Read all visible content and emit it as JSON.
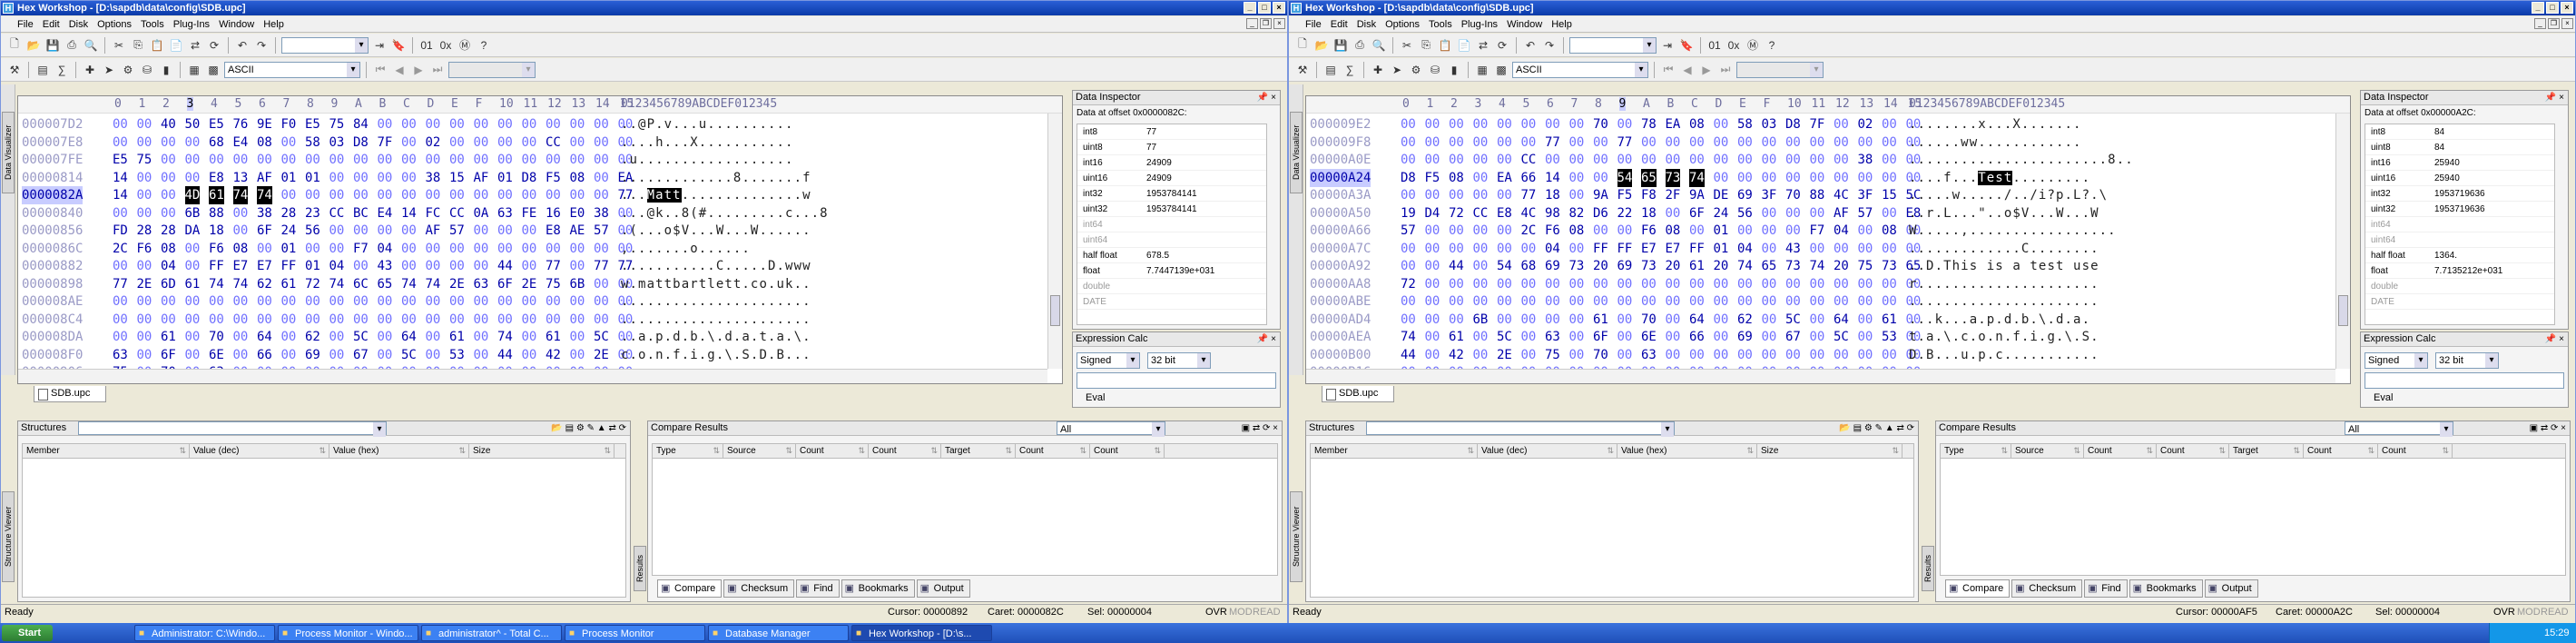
{
  "left": {
    "title": "Hex Workshop - [D:\\sapdb\\data\\config\\SDB.upc]",
    "menu": [
      "File",
      "Edit",
      "Disk",
      "Options",
      "Tools",
      "Plug-Ins",
      "Window",
      "Help"
    ],
    "encoding": "ASCII",
    "vtab_label": "Data Visualizer",
    "col_headers": [
      "0",
      "1",
      "2",
      "3",
      "4",
      "5",
      "6",
      "7",
      "8",
      "9",
      "A",
      "B",
      "C",
      "D",
      "E",
      "F",
      "10",
      "11",
      "12",
      "13",
      "14",
      "15"
    ],
    "ascii_header": "0123456789ABCDEF012345",
    "rows": [
      {
        "off": "000007D2",
        "bytes": [
          "00",
          "00",
          "40",
          "50",
          "E5",
          "76",
          "9E",
          "F0",
          "E5",
          "75",
          "84",
          "00",
          "00",
          "00",
          "00",
          "00",
          "00",
          "00",
          "00",
          "00",
          "00",
          "00"
        ],
        "ascii": "..@P.v...u.........."
      },
      {
        "off": "000007E8",
        "bytes": [
          "00",
          "00",
          "00",
          "00",
          "68",
          "E4",
          "08",
          "00",
          "58",
          "03",
          "D8",
          "7F",
          "00",
          "02",
          "00",
          "00",
          "00",
          "00",
          "CC",
          "00",
          "00",
          "00"
        ],
        "ascii": "....h...X..........."
      },
      {
        "off": "000007FE",
        "bytes": [
          "E5",
          "75",
          "00",
          "00",
          "00",
          "00",
          "00",
          "00",
          "00",
          "00",
          "00",
          "00",
          "00",
          "00",
          "00",
          "00",
          "00",
          "00",
          "00",
          "00",
          "00",
          "00"
        ],
        "ascii": ".u.................."
      },
      {
        "off": "00000814",
        "bytes": [
          "14",
          "00",
          "00",
          "00",
          "E8",
          "13",
          "AF",
          "01",
          "01",
          "00",
          "00",
          "00",
          "00",
          "38",
          "15",
          "AF",
          "01",
          "D8",
          "F5",
          "08",
          "00",
          "EA"
        ],
        "ascii": ".............8.......f"
      },
      {
        "off": "0000082A",
        "bytes": [
          "14",
          "00",
          "00",
          "4D",
          "61",
          "74",
          "74",
          "00",
          "00",
          "00",
          "00",
          "00",
          "00",
          "00",
          "00",
          "00",
          "00",
          "00",
          "00",
          "00",
          "00",
          "77"
        ],
        "ascii": "...Matt..............w",
        "cur": true,
        "sel": [
          3,
          4,
          5,
          6
        ],
        "hl": [
          "...",
          "Matt",
          "..............w"
        ]
      },
      {
        "off": "00000840",
        "bytes": [
          "00",
          "00",
          "00",
          "6B",
          "88",
          "00",
          "38",
          "28",
          "23",
          "CC",
          "BC",
          "E4",
          "14",
          "FC",
          "CC",
          "0A",
          "63",
          "FE",
          "16",
          "E0",
          "38",
          "00"
        ],
        "ascii": "...@k..8(#.........c...8"
      },
      {
        "off": "00000856",
        "bytes": [
          "FD",
          "28",
          "28",
          "DA",
          "18",
          "00",
          "6F",
          "24",
          "56",
          "00",
          "00",
          "00",
          "00",
          "AF",
          "57",
          "00",
          "00",
          "00",
          "E8",
          "AE",
          "57",
          "00"
        ],
        "ascii": ".(...o$V...W...W......"
      },
      {
        "off": "0000086C",
        "bytes": [
          "2C",
          "F6",
          "08",
          "00",
          "F6",
          "08",
          "00",
          "01",
          "00",
          "00",
          "F7",
          "04",
          "00",
          "00",
          "00",
          "00",
          "00",
          "00",
          "00",
          "00",
          "00",
          "00"
        ],
        "ascii": ",.......o......"
      },
      {
        "off": "00000882",
        "bytes": [
          "00",
          "00",
          "04",
          "00",
          "FF",
          "E7",
          "E7",
          "FF",
          "01",
          "04",
          "00",
          "43",
          "00",
          "00",
          "00",
          "00",
          "44",
          "00",
          "77",
          "00",
          "77",
          "77"
        ],
        "ascii": "...........C.....D.www"
      },
      {
        "off": "00000898",
        "bytes": [
          "77",
          "2E",
          "6D",
          "61",
          "74",
          "74",
          "62",
          "61",
          "72",
          "74",
          "6C",
          "65",
          "74",
          "74",
          "2E",
          "63",
          "6F",
          "2E",
          "75",
          "6B",
          "00",
          "00"
        ],
        "ascii": "w.mattbartlett.co.uk.."
      },
      {
        "off": "000008AE",
        "bytes": [
          "00",
          "00",
          "00",
          "00",
          "00",
          "00",
          "00",
          "00",
          "00",
          "00",
          "00",
          "00",
          "00",
          "00",
          "00",
          "00",
          "00",
          "00",
          "00",
          "00",
          "00",
          "00"
        ],
        "ascii": "......................"
      },
      {
        "off": "000008C4",
        "bytes": [
          "00",
          "00",
          "00",
          "00",
          "00",
          "00",
          "00",
          "00",
          "00",
          "00",
          "00",
          "00",
          "00",
          "00",
          "00",
          "00",
          "00",
          "00",
          "00",
          "00",
          "00",
          "00"
        ],
        "ascii": "......................"
      },
      {
        "off": "000008DA",
        "bytes": [
          "00",
          "00",
          "61",
          "00",
          "70",
          "00",
          "64",
          "00",
          "62",
          "00",
          "5C",
          "00",
          "64",
          "00",
          "61",
          "00",
          "74",
          "00",
          "61",
          "00",
          "5C",
          "00"
        ],
        "ascii": "..a.p.d.b.\\.d.a.t.a.\\."
      },
      {
        "off": "000008F0",
        "bytes": [
          "63",
          "00",
          "6F",
          "00",
          "6E",
          "00",
          "66",
          "00",
          "69",
          "00",
          "67",
          "00",
          "5C",
          "00",
          "53",
          "00",
          "44",
          "00",
          "42",
          "00",
          "2E",
          "00"
        ],
        "ascii": "c.o.n.f.i.g.\\.S.D.B..."
      },
      {
        "off": "00000906",
        "bytes": [
          "75",
          "00",
          "70",
          "00",
          "63",
          "00",
          "00",
          "00",
          "00",
          "00",
          "00",
          "00",
          "00",
          "00",
          "00",
          "00",
          "00",
          "00",
          "00",
          "00",
          "00",
          "00"
        ],
        "ascii": "u.p.c................."
      }
    ],
    "doc_tab": "SDB.upc",
    "inspector": {
      "title": "Data Inspector",
      "offset": "Data at offset 0x0000082C:",
      "rows": [
        {
          "k": "int8",
          "v": "77"
        },
        {
          "k": "uint8",
          "v": "77"
        },
        {
          "k": "int16",
          "v": "24909"
        },
        {
          "k": "uint16",
          "v": "24909"
        },
        {
          "k": "int32",
          "v": "1953784141"
        },
        {
          "k": "uint32",
          "v": "1953784141"
        },
        {
          "k": "int64",
          "v": "",
          "grey": true
        },
        {
          "k": "uint64",
          "v": "",
          "grey": true
        },
        {
          "k": "half float",
          "v": "678.5"
        },
        {
          "k": "float",
          "v": "7.7447139e+031"
        },
        {
          "k": "double",
          "v": "",
          "grey": true
        },
        {
          "k": "DATE",
          "v": "",
          "grey": true
        }
      ]
    },
    "expr": {
      "title": "Expression Calc",
      "mode": "Signed",
      "bits": "32 bit",
      "eval": "Eval"
    },
    "structures": {
      "title": "Structures",
      "cols": [
        "Member",
        "Value (dec)",
        "Value (hex)",
        "Size"
      ],
      "vlabel": "Structure Viewer"
    },
    "compare": {
      "title": "Compare Results",
      "filter": "All",
      "cols": [
        "Type",
        "Source",
        "Count",
        "Count",
        "Target",
        "Count",
        "Count"
      ],
      "vlabel": "Results"
    },
    "bottom_tabs": [
      "Compare",
      "Checksum",
      "Find",
      "Bookmarks",
      "Output"
    ],
    "status": {
      "ready": "Ready",
      "cursor": "Cursor: 00000892",
      "caret": "Caret: 0000082C",
      "sel": "Sel: 00000004",
      "ovr": "OVR",
      "mod": "MOD",
      "read": "READ"
    }
  },
  "right": {
    "title": "Hex Workshop - [D:\\sapdb\\data\\config\\SDB.upc]",
    "menu": [
      "File",
      "Edit",
      "Disk",
      "Options",
      "Tools",
      "Plug-Ins",
      "Window",
      "Help"
    ],
    "encoding": "ASCII",
    "vtab_label": "Data Visualizer",
    "col_headers": [
      "0",
      "1",
      "2",
      "3",
      "4",
      "5",
      "6",
      "7",
      "8",
      "9",
      "A",
      "B",
      "C",
      "D",
      "E",
      "F",
      "10",
      "11",
      "12",
      "13",
      "14",
      "15"
    ],
    "ascii_header": "0123456789ABCDEF012345",
    "rows": [
      {
        "off": "000009E2",
        "bytes": [
          "00",
          "00",
          "00",
          "00",
          "00",
          "00",
          "00",
          "00",
          "70",
          "00",
          "78",
          "EA",
          "08",
          "00",
          "58",
          "03",
          "D8",
          "7F",
          "00",
          "02",
          "00",
          "00"
        ],
        "ascii": "........x...X......."
      },
      {
        "off": "000009F8",
        "bytes": [
          "00",
          "00",
          "00",
          "00",
          "00",
          "00",
          "77",
          "00",
          "00",
          "77",
          "00",
          "00",
          "00",
          "00",
          "00",
          "00",
          "00",
          "00",
          "00",
          "00",
          "00",
          "00"
        ],
        "ascii": "......ww............"
      },
      {
        "off": "00000A0E",
        "bytes": [
          "00",
          "00",
          "00",
          "00",
          "00",
          "CC",
          "00",
          "00",
          "00",
          "00",
          "00",
          "00",
          "00",
          "00",
          "00",
          "00",
          "00",
          "00",
          "00",
          "38",
          "00",
          "00"
        ],
        "ascii": ".......................8.."
      },
      {
        "off": "00000A24",
        "bytes": [
          "D8",
          "F5",
          "08",
          "00",
          "EA",
          "66",
          "14",
          "00",
          "00",
          "54",
          "65",
          "73",
          "74",
          "00",
          "00",
          "00",
          "00",
          "00",
          "00",
          "00",
          "00",
          "00"
        ],
        "ascii": "....f...Test.........",
        "cur": true,
        "sel": [
          9,
          10,
          11,
          12
        ],
        "hl": [
          "....f...",
          "Test",
          "........."
        ]
      },
      {
        "off": "00000A3A",
        "bytes": [
          "00",
          "00",
          "00",
          "00",
          "00",
          "77",
          "18",
          "00",
          "9A",
          "F5",
          "F8",
          "2F",
          "9A",
          "DE",
          "69",
          "3F",
          "70",
          "88",
          "4C",
          "3F",
          "15",
          "5C"
        ],
        "ascii": ".....w...../../i?p.L?.\\"
      },
      {
        "off": "00000A50",
        "bytes": [
          "19",
          "D4",
          "72",
          "CC",
          "E8",
          "4C",
          "98",
          "82",
          "D6",
          "22",
          "18",
          "00",
          "6F",
          "24",
          "56",
          "00",
          "00",
          "00",
          "AF",
          "57",
          "00",
          "E8"
        ],
        "ascii": "..r.L...\"..o$V...W...W"
      },
      {
        "off": "00000A66",
        "bytes": [
          "57",
          "00",
          "00",
          "00",
          "00",
          "2C",
          "F6",
          "08",
          "00",
          "00",
          "F6",
          "08",
          "00",
          "01",
          "00",
          "00",
          "00",
          "F7",
          "04",
          "00",
          "08",
          "00"
        ],
        "ascii": "W.....,................."
      },
      {
        "off": "00000A7C",
        "bytes": [
          "00",
          "00",
          "00",
          "00",
          "00",
          "00",
          "04",
          "00",
          "FF",
          "FF",
          "E7",
          "E7",
          "FF",
          "01",
          "04",
          "00",
          "43",
          "00",
          "00",
          "00",
          "00",
          "00"
        ],
        "ascii": ".............C........"
      },
      {
        "off": "00000A92",
        "bytes": [
          "00",
          "00",
          "44",
          "00",
          "54",
          "68",
          "69",
          "73",
          "20",
          "69",
          "73",
          "20",
          "61",
          "20",
          "74",
          "65",
          "73",
          "74",
          "20",
          "75",
          "73",
          "65"
        ],
        "ascii": "..D.This is a test use"
      },
      {
        "off": "00000AA8",
        "bytes": [
          "72",
          "00",
          "00",
          "00",
          "00",
          "00",
          "00",
          "00",
          "00",
          "00",
          "00",
          "00",
          "00",
          "00",
          "00",
          "00",
          "00",
          "00",
          "00",
          "00",
          "00",
          "00"
        ],
        "ascii": "r....................."
      },
      {
        "off": "00000ABE",
        "bytes": [
          "00",
          "00",
          "00",
          "00",
          "00",
          "00",
          "00",
          "00",
          "00",
          "00",
          "00",
          "00",
          "00",
          "00",
          "00",
          "00",
          "00",
          "00",
          "00",
          "00",
          "00",
          "00"
        ],
        "ascii": "......................"
      },
      {
        "off": "00000AD4",
        "bytes": [
          "00",
          "00",
          "00",
          "6B",
          "00",
          "00",
          "00",
          "00",
          "61",
          "00",
          "70",
          "00",
          "64",
          "00",
          "62",
          "00",
          "5C",
          "00",
          "64",
          "00",
          "61",
          "00"
        ],
        "ascii": "...k...a.p.d.b.\\.d.a."
      },
      {
        "off": "00000AEA",
        "bytes": [
          "74",
          "00",
          "61",
          "00",
          "5C",
          "00",
          "63",
          "00",
          "6F",
          "00",
          "6E",
          "00",
          "66",
          "00",
          "69",
          "00",
          "67",
          "00",
          "5C",
          "00",
          "53",
          "00"
        ],
        "ascii": "t.a.\\.c.o.n.f.i.g.\\.S."
      },
      {
        "off": "00000B00",
        "bytes": [
          "44",
          "00",
          "42",
          "00",
          "2E",
          "00",
          "75",
          "00",
          "70",
          "00",
          "63",
          "00",
          "00",
          "00",
          "00",
          "00",
          "00",
          "00",
          "00",
          "00",
          "00",
          "00"
        ],
        "ascii": "D.B...u.p.c..........."
      },
      {
        "off": "00000B16",
        "bytes": [
          "00",
          "00",
          "00",
          "00",
          "00",
          "00",
          "00",
          "00",
          "00",
          "00",
          "00",
          "00",
          "00",
          "00",
          "00",
          "00",
          "00",
          "00",
          "00",
          "00",
          "00",
          "00"
        ],
        "ascii": "......................"
      }
    ],
    "doc_tab": "SDB.upc",
    "inspector": {
      "title": "Data Inspector",
      "offset": "Data at offset 0x00000A2C:",
      "rows": [
        {
          "k": "int8",
          "v": "84"
        },
        {
          "k": "uint8",
          "v": "84"
        },
        {
          "k": "int16",
          "v": "25940"
        },
        {
          "k": "uint16",
          "v": "25940"
        },
        {
          "k": "int32",
          "v": "1953719636"
        },
        {
          "k": "uint32",
          "v": "1953719636"
        },
        {
          "k": "int64",
          "v": "",
          "grey": true
        },
        {
          "k": "uint64",
          "v": "",
          "grey": true
        },
        {
          "k": "half float",
          "v": "1364."
        },
        {
          "k": "float",
          "v": "7.7135212e+031"
        },
        {
          "k": "double",
          "v": "",
          "grey": true
        },
        {
          "k": "DATE",
          "v": "",
          "grey": true
        }
      ]
    },
    "expr": {
      "title": "Expression Calc",
      "mode": "Signed",
      "bits": "32 bit",
      "eval": "Eval"
    },
    "structures": {
      "title": "Structures",
      "cols": [
        "Member",
        "Value (dec)",
        "Value (hex)",
        "Size"
      ],
      "vlabel": "Structure Viewer"
    },
    "compare": {
      "title": "Compare Results",
      "filter": "All",
      "cols": [
        "Type",
        "Source",
        "Count",
        "Count",
        "Target",
        "Count",
        "Count"
      ],
      "vlabel": "Results"
    },
    "bottom_tabs": [
      "Compare",
      "Checksum",
      "Find",
      "Bookmarks",
      "Output"
    ],
    "status": {
      "ready": "Ready",
      "cursor": "Cursor: 00000AF5",
      "caret": "Caret: 00000A2C",
      "sel": "Sel: 00000004",
      "ovr": "OVR",
      "mod": "MOD",
      "read": "READ"
    }
  },
  "taskbar": {
    "start": "Start",
    "tasks": [
      "Administrator: C:\\Windo...",
      "Process Monitor - Windo...",
      "administrator^ - Total C...",
      "Process Monitor",
      "Database Manager",
      "Hex Workshop - [D:\\s..."
    ],
    "clock": "15:29"
  }
}
